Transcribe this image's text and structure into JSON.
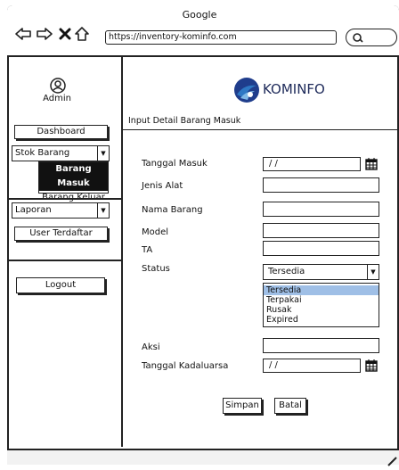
{
  "window": {
    "title": "Google"
  },
  "browser": {
    "url": "https://inventory-kominfo.com"
  },
  "sidebar": {
    "user_label": "Admin",
    "dashboard": "Dashboard",
    "stok_select": "Stok Barang",
    "stok_menu": [
      {
        "label": "Barang Masuk",
        "active": true
      },
      {
        "label": "Barang Keluar",
        "active": false
      }
    ],
    "laporan_select": "Laporan",
    "user_terdaftar": "User Terdaftar",
    "logout": "Logout"
  },
  "header": {
    "brand": "KOMINFO",
    "logo_colors": [
      "#1f3d8c",
      "#2e78c4",
      "#7fb8e6"
    ]
  },
  "main": {
    "title": "Input Detail Barang Masuk",
    "form": {
      "tanggal_masuk_label": "Tanggal Masuk",
      "tanggal_masuk_value": "/ /",
      "jenis_alat_label": "Jenis Alat",
      "nama_barang_label": "Nama Barang",
      "model_label": "Model",
      "ta_label": "TA",
      "status_label": "Status",
      "status_value": "Tersedia",
      "status_options": [
        "Tersedia",
        "Terpakai",
        "Rusak",
        "Expired"
      ],
      "aksi_label": "Aksi",
      "kadaluarsa_label": "Tanggal Kadaluarsa",
      "kadaluarsa_value": "/ /"
    },
    "simpan": "Simpan",
    "batal": "Batal"
  },
  "colors": {
    "highlight": "#9fbfe6",
    "menu_active_bg": "#111111"
  }
}
